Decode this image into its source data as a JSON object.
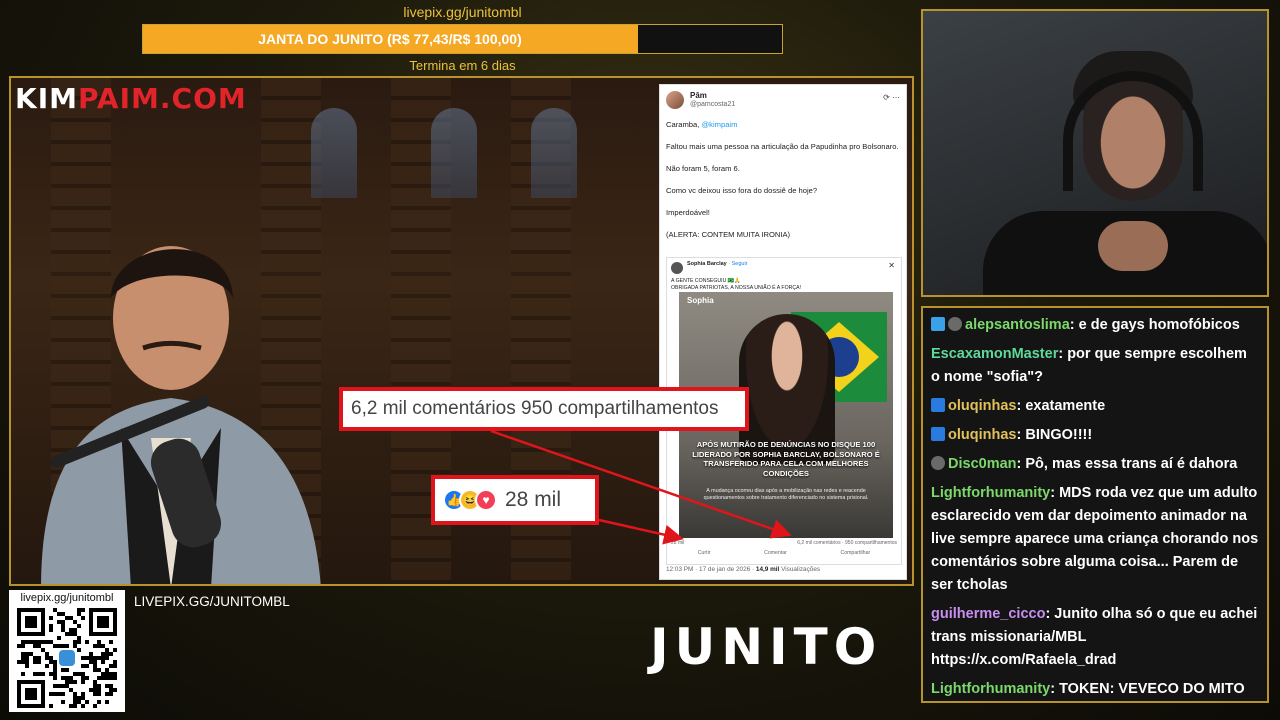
{
  "donation": {
    "url": "livepix.gg/junitombl",
    "goal_label": "JANTA DO JUNITO (R$ 77,43/R$ 100,00)",
    "progress": 0.7743,
    "ends": "Termina em 6 dias"
  },
  "main": {
    "logo_part1": "KIM",
    "logo_part2": "PAIM.COM",
    "annotation_stats": "6,2 mil comentários   950 compartilhamentos",
    "annotation_likes": "28 mil",
    "tweet": {
      "name": "Pâm",
      "handle": "@pamcosta21",
      "line1_prefix": "Caramba, ",
      "line1_mention": "@kimpaim",
      "line2": "Faltou mais uma pessoa na articulação da Papudinha pro Bolsonaro.",
      "line3": "Não foram 5, foram 6.",
      "line4": "Como vc deixou isso fora do dossiê de hoje?",
      "line5": "Imperdoável!",
      "line6": "(ALERTA: CONTEM MUITA IRONIA)",
      "footer_time": "12:03 PM · 17 de jan de 2026 · ",
      "footer_views": "14,9 mil",
      "footer_views_label": " Visualizações",
      "fb": {
        "name": "Sophia Barclay",
        "follow": " · Seguir",
        "text1": "A GENTE CONSEGUIU 🇧🇷🙏",
        "text2": "OBRIGADA PATRIOTAS, A NOSSA UNIÃO É A FORÇA!",
        "tag": "Sophia",
        "headline": "APÓS MUTIRÃO DE DENÚNCIAS NO DISQUE 100 LIDERADO POR SOPHIA BARCLAY, BOLSONARO É TRANSFERIDO PARA CELA COM MELHORES CONDIÇÕES",
        "sub": "A mudança ocorreu dias após a mobilização nas redes e reacende questionamentos sobre tratamento diferenciado no sistema prisional.",
        "likes": "28 mil",
        "stats": "6,2 mil comentários · 950 compartilhamentos",
        "action_like": "Curtir",
        "action_comment": "Comentar",
        "action_share": "Compartilhar"
      }
    }
  },
  "chat": {
    "messages": [
      {
        "user": "alepsantoslima",
        "color": "#7cd86b",
        "text": ": e de gays homofóbicos"
      },
      {
        "user": "EscaxamonMaster",
        "color": "#5fd99a",
        "text": ": por que sempre escolhem o nome \"sofia\"?"
      },
      {
        "user": "oluqinhas",
        "color": "#e0c15a",
        "text": ": exatamente"
      },
      {
        "user": "oluqinhas",
        "color": "#e0c15a",
        "text": ": BINGO!!!!"
      },
      {
        "user": "Disc0man",
        "color": "#7cd86b",
        "text": ": Pô, mas essa trans aí é dahora"
      },
      {
        "user": "Lightforhumanity",
        "color": "#7cd86b",
        "text": ": MDS roda vez que um adulto esclarecido vem dar depoimento animador na live sempre aparece uma criança chorando nos comentários sobre alguma coisa... Parem de ser tcholas"
      },
      {
        "user": "guilherme_cicco",
        "color": "#c98ff0",
        "text": ": Junito olha só o que eu achei trans missionaria/MBL https://x.com/Rafaela_drad"
      },
      {
        "user": "Lightforhumanity",
        "color": "#7cd86b",
        "text": ": TOKEN: VEVECO DO MITO"
      }
    ]
  },
  "bottom": {
    "qr_url": "livepix.gg/junitombl",
    "livepix_label": "LIVEPIX.GG/JUNITOMBL",
    "brand": "JUNITO"
  },
  "colors": {
    "accent": "#c9a230",
    "goal_fill": "#f4a824",
    "annotation": "#e0151b"
  }
}
